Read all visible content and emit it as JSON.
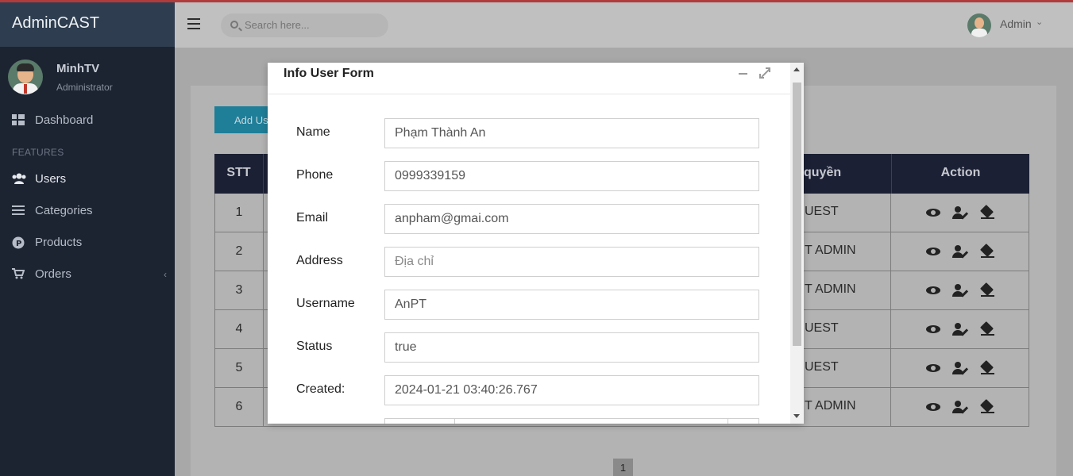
{
  "app": {
    "brand": "AdminCAST"
  },
  "sidebar": {
    "user": {
      "name": "MinhTV",
      "role": "Administrator"
    },
    "section_label": "FEATURES",
    "items": [
      {
        "label": "Dashboard",
        "icon": "dashboard-icon"
      },
      {
        "label": "Users",
        "icon": "users-icon"
      },
      {
        "label": "Categories",
        "icon": "list-icon"
      },
      {
        "label": "Products",
        "icon": "product-icon"
      },
      {
        "label": "Orders",
        "icon": "cart-icon"
      }
    ]
  },
  "header": {
    "search_placeholder": "Search here...",
    "admin_label": "Admin"
  },
  "content": {
    "add_button": "Add Us",
    "table": {
      "headers": {
        "stt": "STT",
        "role": "quyền",
        "action": "Action"
      },
      "rows": [
        {
          "stt": "1",
          "role": "UEST"
        },
        {
          "stt": "2",
          "role": "T ADMIN"
        },
        {
          "stt": "3",
          "role": "T ADMIN"
        },
        {
          "stt": "4",
          "role": "UEST"
        },
        {
          "stt": "5",
          "role": "UEST"
        },
        {
          "stt": "6",
          "role": "T ADMIN"
        }
      ]
    },
    "pagination": {
      "current": "1"
    }
  },
  "modal": {
    "title": "Info User Form",
    "fields": {
      "name": {
        "label": "Name",
        "value": "Phạm Thành An"
      },
      "phone": {
        "label": "Phone",
        "value": "0999339159"
      },
      "email": {
        "label": "Email",
        "value": "anpham@gmai.com"
      },
      "address": {
        "label": "Address",
        "value": "",
        "placeholder": "Địa chỉ"
      },
      "username": {
        "label": "Username",
        "value": "AnPT"
      },
      "status": {
        "label": "Status",
        "value": "true"
      },
      "created": {
        "label": "Created:",
        "value": "2024-01-21 03:40:26.767"
      }
    }
  },
  "colors": {
    "sidebar_bg": "#1c2331",
    "brand_bg": "#2e3d4f",
    "table_header_bg": "#1c2034",
    "accent_button": "#1f7e98"
  }
}
